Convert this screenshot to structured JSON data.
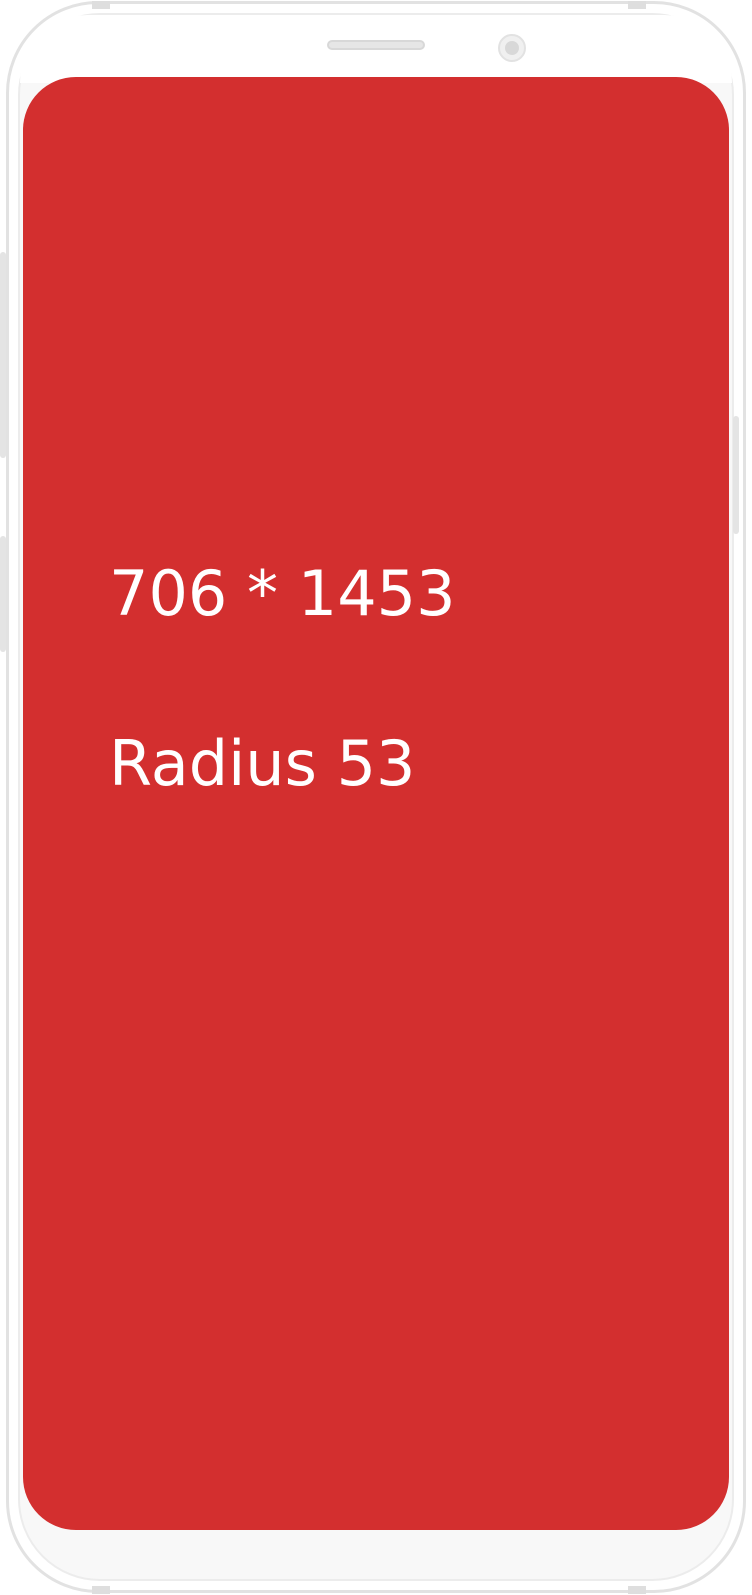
{
  "screen": {
    "dimensions_label": "706 * 1453",
    "radius_label": "Radius 53",
    "background_color": "#d32f2f",
    "text_color": "#ffffff"
  },
  "device": {
    "frame_color": "#e2e2e2",
    "body_color": "#ffffff",
    "icons": [
      "speaker-grille-icon",
      "front-camera-icon"
    ]
  }
}
